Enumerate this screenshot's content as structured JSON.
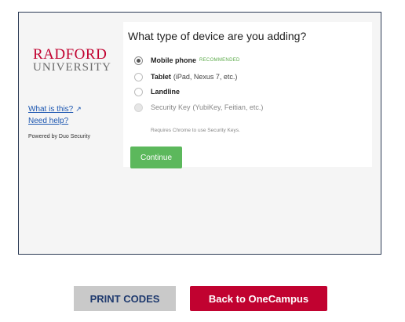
{
  "brand": {
    "line1": "RADFORD",
    "line2": "UNIVERSITY",
    "primary_color": "#c10230"
  },
  "sidebar": {
    "what_is_this": "What is this?",
    "what_is_this_icon": "external-link-icon",
    "need_help": "Need help?",
    "powered_by": "Powered by Duo Security"
  },
  "prompt": {
    "title": "What type of device are you adding?",
    "options": [
      {
        "label": "Mobile phone",
        "detail": "",
        "badge": "RECOMMENDED",
        "checked": true,
        "disabled": false
      },
      {
        "label": "Tablet",
        "detail": "(iPad, Nexus 7, etc.)",
        "checked": false,
        "disabled": false
      },
      {
        "label": "Landline",
        "detail": "",
        "checked": false,
        "disabled": false
      },
      {
        "label": "Security Key",
        "detail": "(YubiKey, Feitian, etc.)",
        "checked": false,
        "disabled": true
      }
    ],
    "security_key_note": "Requires Chrome to use Security Keys.",
    "continue_label": "Continue",
    "continue_color": "#5cb85c"
  },
  "footer": {
    "print_codes": "PRINT CODES",
    "back": "Back to OneCampus"
  }
}
